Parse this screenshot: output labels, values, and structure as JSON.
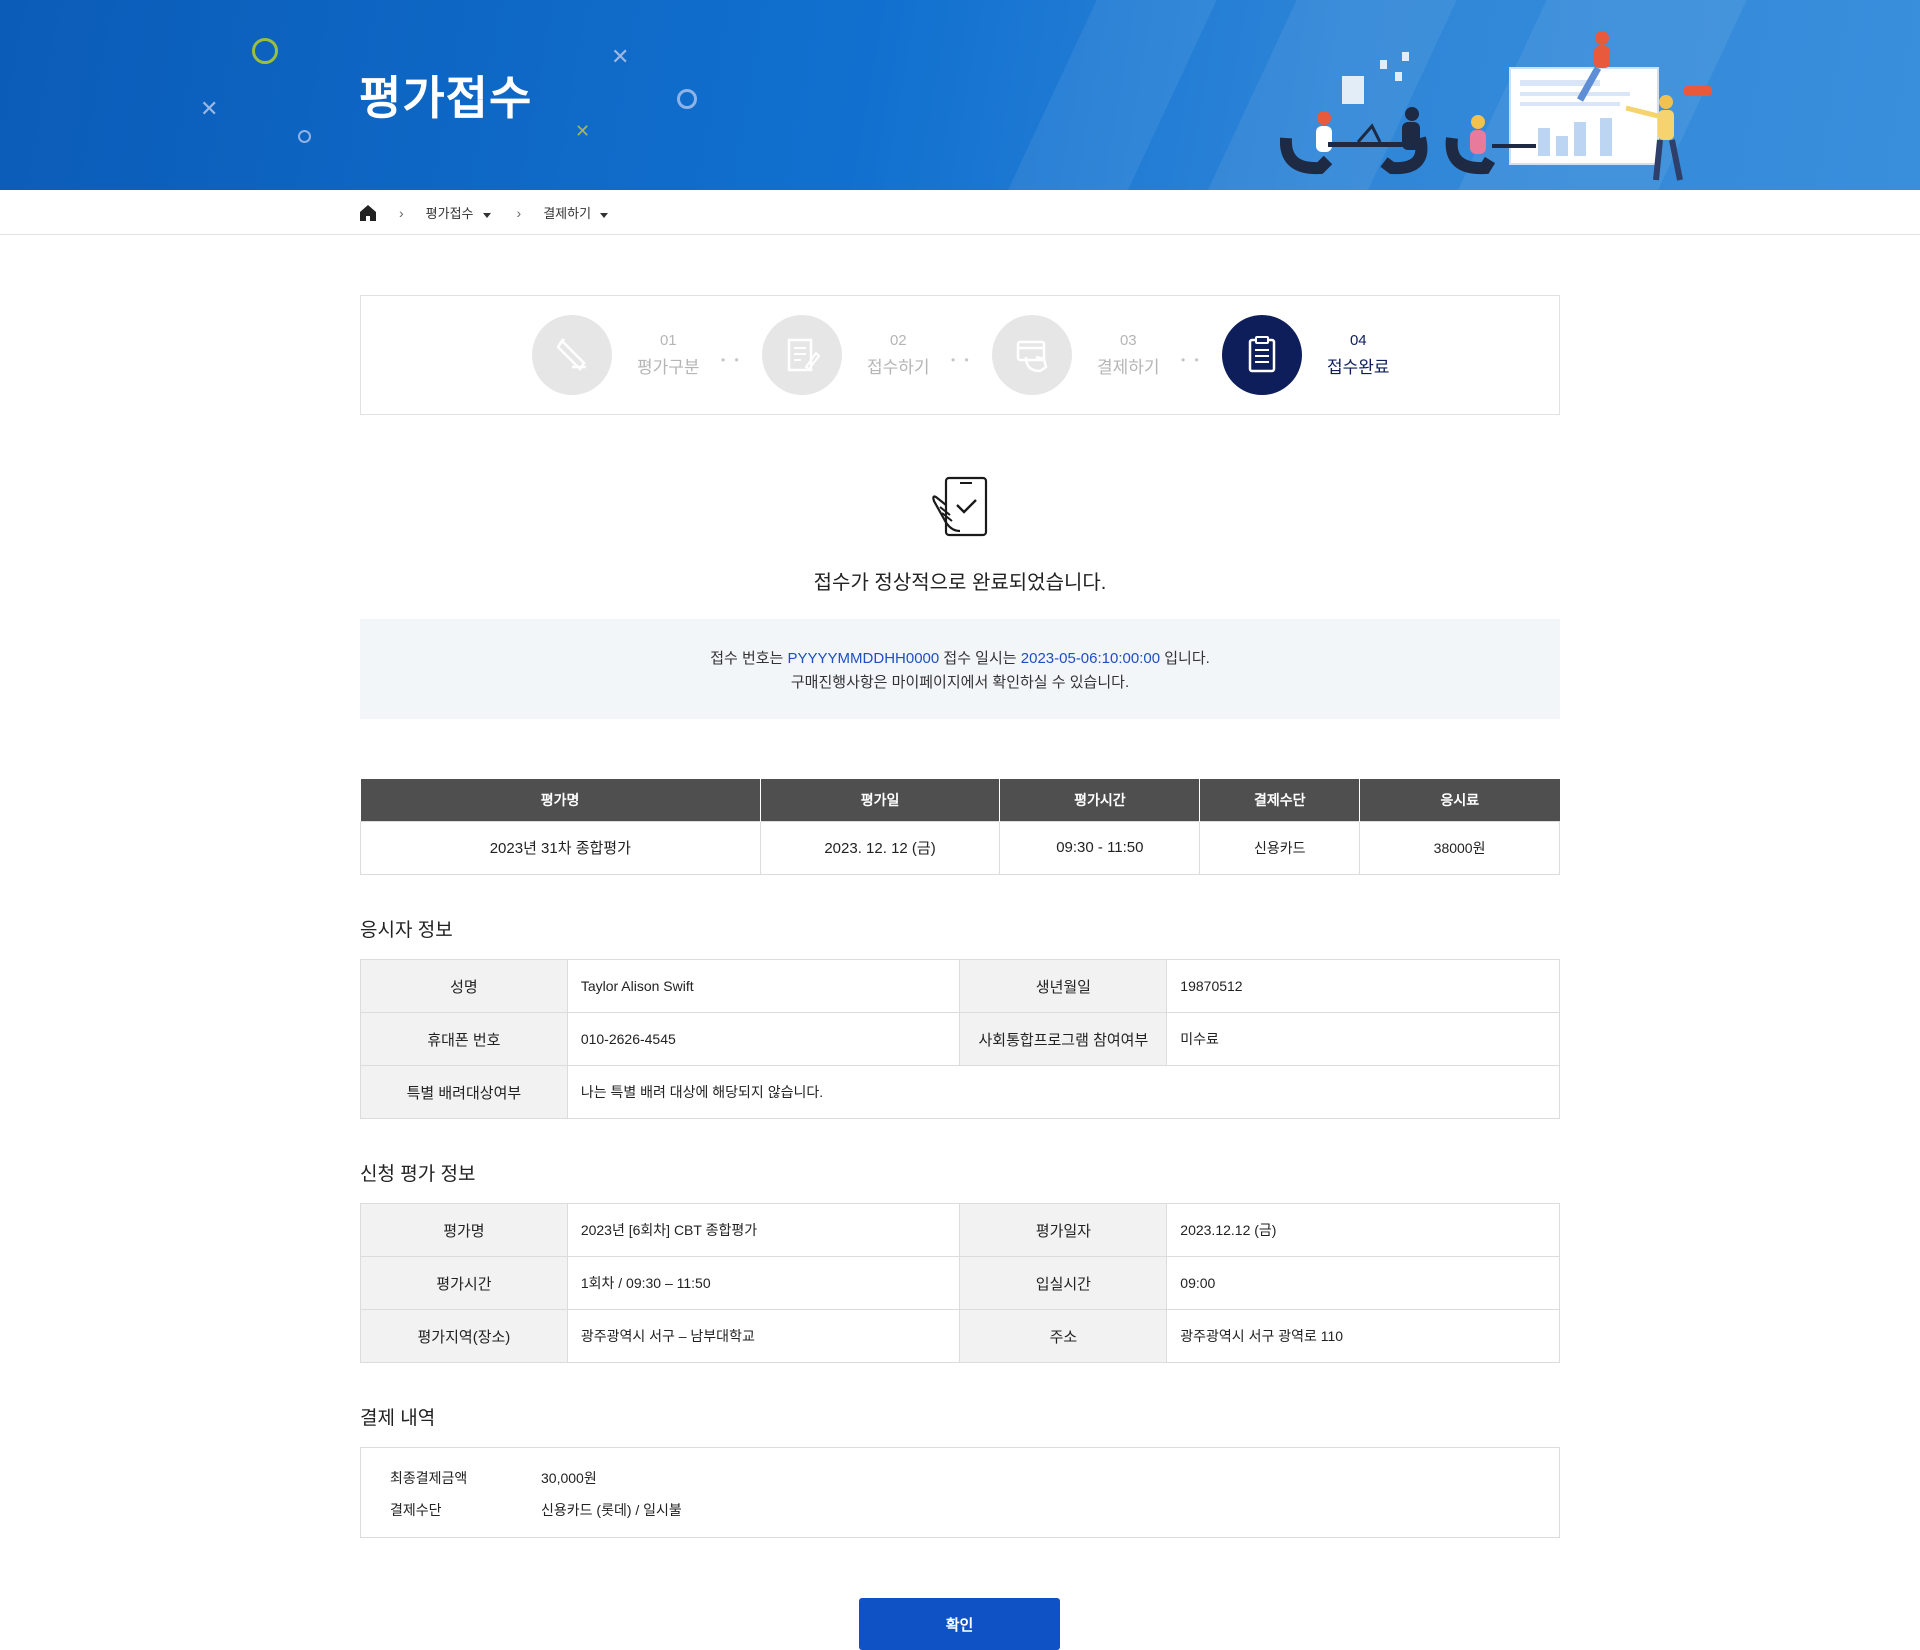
{
  "header": {
    "title": "평가접수"
  },
  "breadcrumb": {
    "home_icon": "home-icon",
    "items": [
      {
        "label": "평가접수"
      },
      {
        "label": "결제하기"
      }
    ]
  },
  "steps": [
    {
      "num": "01",
      "name": "평가구분",
      "icon": "pen-icon",
      "active": false
    },
    {
      "num": "02",
      "name": "접수하기",
      "icon": "document-edit-icon",
      "active": false
    },
    {
      "num": "03",
      "name": "결제하기",
      "icon": "card-payment-icon",
      "active": false
    },
    {
      "num": "04",
      "name": "접수완료",
      "icon": "clipboard-icon",
      "active": true
    }
  ],
  "completion": {
    "icon": "tablet-check-icon",
    "message": "접수가 정상적으로 완료되었습니다.",
    "notice": {
      "prefix": "접수 번호는 ",
      "receipt_no": "PYYYYMMDDHH0000",
      "middle": " 접수 일시는 ",
      "datetime": "2023-05-06:10:00:00",
      "suffix": " 입니다.",
      "line2": "구매진행사항은 마이페이지에서 확인하실 수 있습니다."
    }
  },
  "summary": {
    "headers": [
      "평가명",
      "평가일",
      "평가시간",
      "결제수단",
      "응시료"
    ],
    "row": [
      "2023년 31차 종합평가",
      "2023. 12. 12 (금)",
      "09:30 - 11:50",
      "신용카드",
      "38000원"
    ]
  },
  "applicant": {
    "title": "응시자 정보",
    "name_label": "성명",
    "name": "Taylor Alison Swift",
    "birth_label": "생년월일",
    "birth": "19870512",
    "phone_label": "휴대폰 번호",
    "phone": "010-2626-4545",
    "program_label": "사회통합프로그램 참여여부",
    "program": "미수료",
    "special_label": "특별 배려대상여부",
    "special": "나는 특별 배려 대상에 해당되지 않습니다."
  },
  "application": {
    "title": "신청 평가 정보",
    "exam_label": "평가명",
    "exam": "2023년 [6회차] CBT 종합평가",
    "date_label": "평가일자",
    "date": "2023.12.12 (금)",
    "time_label": "평가시간",
    "time": "1회차 / 09:30 – 11:50",
    "entry_label": "입실시간",
    "entry": "09:00",
    "region_label": "평가지역(장소)",
    "region": "광주광역시 서구 – 남부대학교",
    "addr_label": "주소",
    "addr": "광주광역시 서구 광역로 110"
  },
  "payment": {
    "title": "결제 내역",
    "amount_label": "최종결제금액",
    "amount": "30,000원",
    "method_label": "결제수단",
    "method": "신용카드 (롯데) / 일시불"
  },
  "confirm_label": "확인",
  "colors": {
    "primary": "#0e52c5",
    "step_active": "#0e1e5b",
    "highlight": "#1d4fc4",
    "table_header": "#4f4f4f"
  }
}
